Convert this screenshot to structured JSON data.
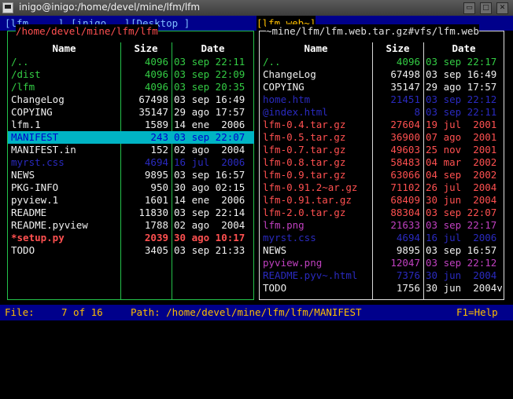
{
  "window": {
    "title": "inigo@inigo:/home/devel/mine/lfm/lfm"
  },
  "tabs": [
    {
      "label": "[lfm     ]"
    },
    {
      "label": "[inigo   ]"
    },
    {
      "label": "[Desktop ]"
    },
    {
      "label": "[lfm.web~]"
    }
  ],
  "left_panel": {
    "title": "/home/devel/mine/lfm/lfm",
    "headers": {
      "name": "Name",
      "size": "Size",
      "date": "Date"
    },
    "rows": [
      {
        "name": "/..",
        "size": "4096",
        "date": "03 sep 22:11",
        "color": "#33cc44"
      },
      {
        "name": "/dist",
        "size": "4096",
        "date": "03 sep 22:09",
        "color": "#33cc44"
      },
      {
        "name": "/lfm",
        "size": "4096",
        "date": "03 sep 20:35",
        "color": "#33cc44"
      },
      {
        "name": "ChangeLog",
        "size": "67498",
        "date": "03 sep 16:49",
        "color": "#f0f0f0"
      },
      {
        "name": "COPYING",
        "size": "35147",
        "date": "29 ago 17:57",
        "color": "#f0f0f0"
      },
      {
        "name": "lfm.1",
        "size": "1589",
        "date": "14 ene  2006",
        "color": "#f0f0f0"
      },
      {
        "name": "MANIFEST",
        "size": "243",
        "date": "03 sep 22:07",
        "color": "#0000cc",
        "selected": true
      },
      {
        "name": "MANIFEST.in",
        "size": "152",
        "date": "02 ago  2004",
        "color": "#f0f0f0"
      },
      {
        "name": "myrst.css",
        "size": "4694",
        "date": "16 jul  2006",
        "color": "#2a2abf"
      },
      {
        "name": "NEWS",
        "size": "9895",
        "date": "03 sep 16:57",
        "color": "#f0f0f0"
      },
      {
        "name": "PKG-INFO",
        "size": "950",
        "date": "30 ago 02:15",
        "color": "#f0f0f0"
      },
      {
        "name": "pyview.1",
        "size": "1601",
        "date": "14 ene  2006",
        "color": "#f0f0f0"
      },
      {
        "name": "README",
        "size": "11830",
        "date": "03 sep 22:14",
        "color": "#f0f0f0"
      },
      {
        "name": "README.pyview",
        "size": "1788",
        "date": "02 ago  2004",
        "color": "#f0f0f0"
      },
      {
        "name": "*setup.py",
        "size": "2039",
        "date": "30 ago 10:17",
        "color": "#ff5050",
        "bold": true
      },
      {
        "name": "TODO",
        "size": "3405",
        "date": "03 sep 21:33",
        "color": "#f0f0f0"
      }
    ]
  },
  "right_panel": {
    "title": "~mine/lfm/lfm.web.tar.gz#vfs/lfm.web",
    "headers": {
      "name": "Name",
      "size": "Size",
      "date": "Date"
    },
    "rows": [
      {
        "name": "/..",
        "size": "4096",
        "date": "03 sep 22:17",
        "color": "#33cc44"
      },
      {
        "name": "ChangeLog",
        "size": "67498",
        "date": "03 sep 16:49",
        "color": "#f0f0f0"
      },
      {
        "name": "COPYING",
        "size": "35147",
        "date": "29 ago 17:57",
        "color": "#f0f0f0"
      },
      {
        "name": "home.htm",
        "size": "21451",
        "date": "03 sep 22:12",
        "color": "#2a2abf"
      },
      {
        "name": "@index.html",
        "size": "8",
        "date": "03 sep 22:11",
        "color": "#2a2abf"
      },
      {
        "name": "lfm-0.4.tar.gz",
        "size": "27604",
        "date": "19 jul  2001",
        "color": "#ff5050"
      },
      {
        "name": "lfm-0.5.tar.gz",
        "size": "36900",
        "date": "07 ago  2001",
        "color": "#ff5050"
      },
      {
        "name": "lfm-0.7.tar.gz",
        "size": "49603",
        "date": "25 nov  2001",
        "color": "#ff5050"
      },
      {
        "name": "lfm-0.8.tar.gz",
        "size": "58483",
        "date": "04 mar  2002",
        "color": "#ff5050"
      },
      {
        "name": "lfm-0.9.tar.gz",
        "size": "63066",
        "date": "04 sep  2002",
        "color": "#ff5050"
      },
      {
        "name": "lfm-0.91.2~ar.gz",
        "size": "71102",
        "date": "26 jul  2004",
        "color": "#ff5050"
      },
      {
        "name": "lfm-0.91.tar.gz",
        "size": "68409",
        "date": "30 jun  2004",
        "color": "#ff5050"
      },
      {
        "name": "lfm-2.0.tar.gz",
        "size": "88304",
        "date": "03 sep 22:07",
        "color": "#ff5050"
      },
      {
        "name": "lfm.png",
        "size": "21633",
        "date": "03 sep 22:17",
        "color": "#c040c0"
      },
      {
        "name": "myrst.css",
        "size": "4694",
        "date": "16 jul  2006",
        "color": "#2a2abf"
      },
      {
        "name": "NEWS",
        "size": "9895",
        "date": "03 sep 16:57",
        "color": "#f0f0f0"
      },
      {
        "name": "pyview.png",
        "size": "12047",
        "date": "03 sep 22:12",
        "color": "#c040c0"
      },
      {
        "name": "README.pyv~.html",
        "size": "7376",
        "date": "30 jun  2004",
        "color": "#2a2abf"
      },
      {
        "name": "TODO",
        "size": "1756",
        "date": "30 jun  2004v",
        "color": "#f0f0f0"
      }
    ]
  },
  "statusbar": {
    "file_label": "File:",
    "position": "7 of 16",
    "path_label": "Path: /home/devel/mine/lfm/lfm/MANIFEST",
    "help": "F1=Help"
  }
}
